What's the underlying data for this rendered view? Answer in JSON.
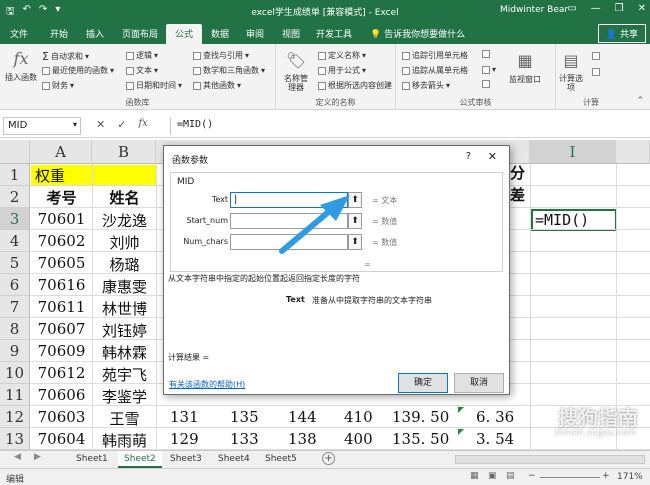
{
  "titlebar": {
    "title": "excel学生成绩单 [兼容模式] - Excel",
    "user": "Midwinter Bear"
  },
  "tabs": [
    {
      "label": "文件"
    },
    {
      "label": "开始"
    },
    {
      "label": "插入"
    },
    {
      "label": "页面布局"
    },
    {
      "label": "公式",
      "active": true
    },
    {
      "label": "数据"
    },
    {
      "label": "审阅"
    },
    {
      "label": "视图"
    },
    {
      "label": "开发工具"
    }
  ],
  "tellme": "告诉我你想要做什么",
  "share": "共享",
  "ribbon": {
    "insert_function": "插入函数",
    "autosum": "自动求和",
    "recent": "最近使用的函数",
    "financial": "财务",
    "logical": "逻辑",
    "text": "文本",
    "datetime": "日期和时间",
    "lookup": "查找与引用",
    "math": "数学和三角函数",
    "more": "其他函数",
    "library_label": "函数库",
    "name_manager": "名称管理器",
    "define_name": "定义名称",
    "use_in_formula": "用于公式",
    "create_from_selection": "根据所选内容创建",
    "names_label": "定义的名称",
    "trace_precedents": "追踪引用单元格",
    "trace_dependents": "追踪从属单元格",
    "remove_arrows": "移去箭头",
    "audit_label": "公式审核",
    "watch_window": "监视窗口",
    "calc_options": "计算选项",
    "calc_label": "计算"
  },
  "formulabar": {
    "namebox": "MID",
    "formula": "=MID()"
  },
  "grid": {
    "columns": [
      "A",
      "B",
      "I"
    ],
    "rows": [
      "1",
      "2",
      "3",
      "4",
      "5",
      "6",
      "7",
      "8",
      "9",
      "10",
      "11",
      "12",
      "13"
    ],
    "title_cell": "权重",
    "header_a": "考号",
    "header_b": "姓名",
    "header_right": "分",
    "header_right2": "差",
    "active_cell": "=MID()",
    "records": [
      {
        "id": "70601",
        "name": "沙龙逸"
      },
      {
        "id": "70602",
        "name": "刘帅"
      },
      {
        "id": "70605",
        "name": "杨璐"
      },
      {
        "id": "70616",
        "name": "康惠雯"
      },
      {
        "id": "70611",
        "name": "林世博"
      },
      {
        "id": "70607",
        "name": "刘钰婷"
      },
      {
        "id": "70609",
        "name": "韩林霖"
      },
      {
        "id": "70612",
        "name": "苑宇飞"
      },
      {
        "id": "70606",
        "name": "李鉴学"
      },
      {
        "id": "70603",
        "name": "王雪",
        "c": "131",
        "d": "135",
        "e": "144",
        "f": "410",
        "g": "139. 50",
        "h": "6. 36"
      },
      {
        "id": "70604",
        "name": "韩雨萌",
        "c": "129",
        "d": "133",
        "e": "138",
        "f": "400",
        "g": "135. 50",
        "h": "3. 54"
      }
    ]
  },
  "sheets": [
    "Sheet1",
    "Sheet2",
    "Sheet3",
    "Sheet4",
    "Sheet5"
  ],
  "active_sheet": "Sheet2",
  "status": {
    "left": "编辑",
    "zoom": "171%"
  },
  "dialog": {
    "title": "函数参数",
    "help_q": "?",
    "close": "✕",
    "function_name": "MID",
    "args": [
      {
        "label": "Text",
        "hint": "= 文本"
      },
      {
        "label": "Start_num",
        "hint": "= 数值"
      },
      {
        "label": "Num_chars",
        "hint": "= 数值"
      }
    ],
    "result_eq": "=",
    "description": "从文本字符串中指定的起始位置起返回指定长度的字符",
    "arg_desc_label": "Text",
    "arg_desc": "准备从中提取字符串的文本字符串",
    "calc_result": "计算结果 =",
    "help_link": "有关该函数的帮助(H)",
    "ok": "确定",
    "cancel": "取消"
  },
  "watermark": {
    "text": "搜狗指南",
    "url": "zhinan.sogou.com"
  }
}
